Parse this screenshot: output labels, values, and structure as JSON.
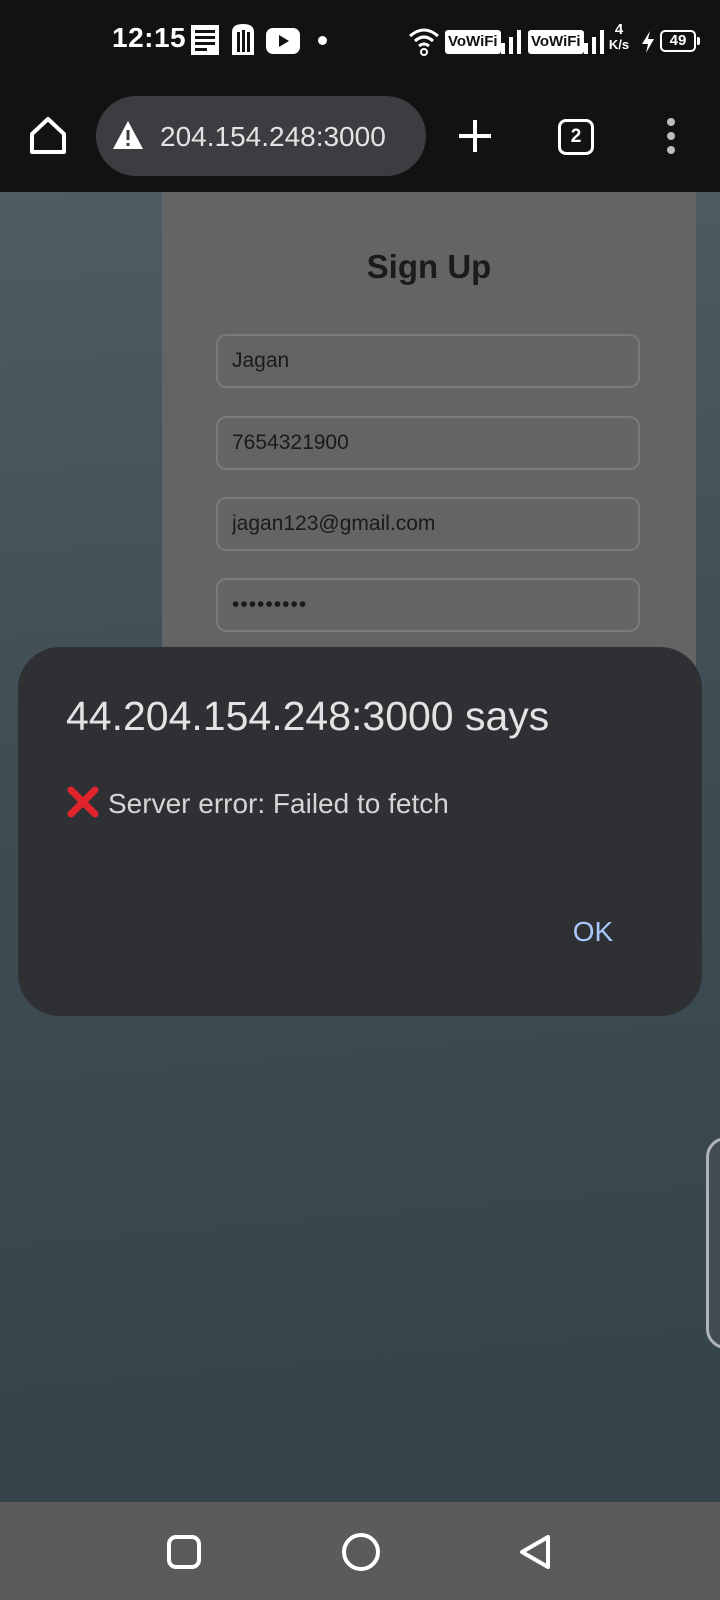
{
  "status_bar": {
    "time": "12:15",
    "vowifi_1": "VoWiFi",
    "vowifi_2": "VoWiFi",
    "net_speed_value": "4",
    "net_speed_unit": "K/s",
    "battery_level": "49"
  },
  "browser": {
    "url": "204.154.248:3000",
    "tab_count": "2"
  },
  "form": {
    "title": "Sign Up",
    "name_value": "Jagan",
    "phone_value": "7654321900",
    "email_value": "jagan123@gmail.com",
    "password_value": "•••••••••"
  },
  "dialog": {
    "title": "44.204.154.248:3000 says",
    "message": "Server error: Failed to fetch",
    "ok_label": "OK",
    "error_icon_color": "#e0242c"
  },
  "colors": {
    "dialog_bg": "#2f3034",
    "link_blue": "#a8c7fa"
  }
}
